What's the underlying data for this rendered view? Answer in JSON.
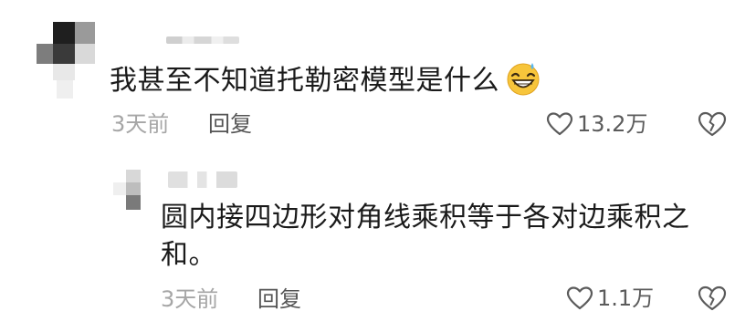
{
  "comments": [
    {
      "text": "我甚至不知道托勒密模型是什么",
      "emoji": "grinning-sweat-emoji",
      "time": "3天前",
      "reply_label": "回复",
      "likes": "13.2万"
    }
  ],
  "replies": [
    {
      "text": "圆内接四边形对角线乘积等于各对边乘积之和。",
      "time": "3天前",
      "reply_label": "回复",
      "likes": "1.1万"
    }
  ],
  "icons": {
    "like": "heart-outline-icon",
    "dislike": "broken-heart-icon"
  },
  "colors": {
    "text": "#1a1a1a",
    "meta": "#a6a6a6",
    "icon": "#5b5b5b"
  }
}
